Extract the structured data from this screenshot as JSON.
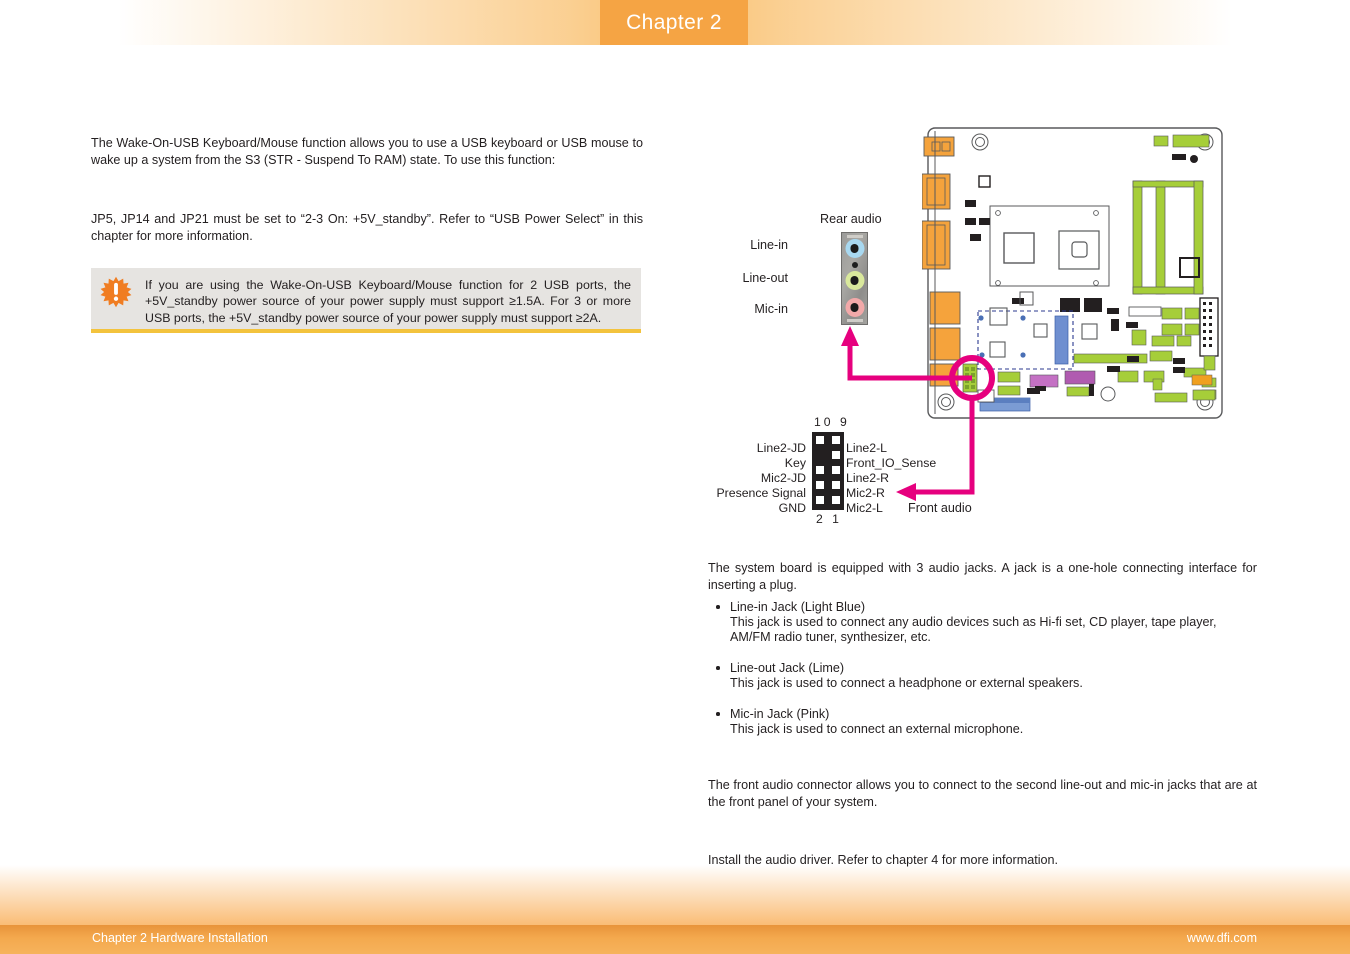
{
  "header": {
    "chapter_tab_label": "Chapter 2",
    "accent_color": "#f5a444"
  },
  "footer": {
    "left_text": "Chapter 2 Hardware Installation",
    "right_text": "www.dfi.com",
    "bar_color": "#f4a94e"
  },
  "body": {
    "wake_on_usb_paragraph": "The Wake-On-USB Keyboard/Mouse function allows you to use a USB keyboard or USB mouse to wake up a system from the S3 (STR - Suspend To RAM) state. To use this function:",
    "jumper_paragraph": "JP5, JP14 and JP21 must be set to “2-3 On: +5V_standby”. Refer to “USB Power Select” in this chapter for more information.",
    "audio_jacks_paragraph": "The system board is equipped with 3 audio jacks. A jack is a one-hole connecting interface for inserting a plug.",
    "front_audio_paragraph": "The front audio connector allows you to connect to the second line-out and mic-in jacks that are at the front panel of your system.",
    "driver_paragraph": "Install the audio driver. Refer to chapter 4 for more information."
  },
  "note": {
    "icon": "warning-starburst-icon",
    "text": "If you are using the Wake-On-USB Keyboard/Mouse function for 2 USB ports, the +5V_standby power source of your power supply must support ≥1.5A. For 3 or more USB ports, the +5V_standby power source of your power supply must support ≥2A.",
    "background_color": "#e6e4e1",
    "accent_color": "#f3c33d"
  },
  "jack_list": [
    {
      "title": "Line-in Jack (Light Blue)",
      "description": "This jack is used to connect any audio devices such as Hi-fi set, CD player, tape player, AM/FM radio tuner, synthesizer, etc."
    },
    {
      "title": "Line-out Jack (Lime)",
      "description": "This jack is used to connect a headphone or external speakers."
    },
    {
      "title": "Mic-in Jack (Pink)",
      "description": "This jack is used to connect an external microphone."
    }
  ],
  "rear_audio": {
    "caption": "Rear audio",
    "jacks": [
      {
        "label": "Line-in",
        "color": "#a8d8f0"
      },
      {
        "label": "Line-out",
        "color": "#d9e89c"
      },
      {
        "label": "Mic-in",
        "color": "#f2a9a9"
      }
    ]
  },
  "front_audio_connector": {
    "caption": "Front audio",
    "top_pin_numbers": "10  9",
    "bottom_pin_numbers": "2  1",
    "left_labels": [
      "Line2-JD",
      "Key",
      "Mic2-JD",
      "Presence Signal",
      "GND"
    ],
    "right_labels": [
      "Line2-L",
      "Front_IO_Sense",
      "Line2-R",
      "Mic2-R",
      "Mic2-L"
    ]
  },
  "diagram": {
    "callout_color": "#e6007e",
    "board_outline_color": "#58595b"
  }
}
